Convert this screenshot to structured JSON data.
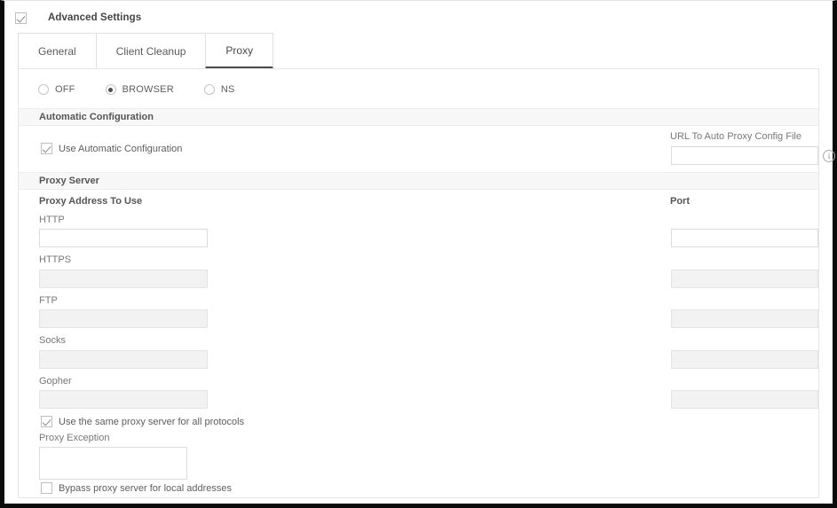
{
  "header": {
    "advanced_settings_label": "Advanced Settings",
    "advanced_settings_checked": true
  },
  "tabs": [
    {
      "label": "General",
      "active": false
    },
    {
      "label": "Client Cleanup",
      "active": false
    },
    {
      "label": "Proxy",
      "active": true
    }
  ],
  "proxy_mode": {
    "options": [
      {
        "label": "OFF",
        "selected": false
      },
      {
        "label": "BROWSER",
        "selected": true
      },
      {
        "label": "NS",
        "selected": false
      }
    ]
  },
  "automatic_configuration": {
    "section_title": "Automatic Configuration",
    "use_automatic_configuration_label": "Use Automatic Configuration",
    "use_automatic_configuration_checked": true,
    "url_label": "URL To Auto Proxy Config File",
    "url_value": "",
    "url_placeholder": "",
    "info_icon": "info-icon",
    "info_glyph": "i"
  },
  "proxy_server": {
    "section_title": "Proxy Server",
    "address_header": "Proxy Address To Use",
    "port_header": "Port",
    "rows": [
      {
        "protocol": "HTTP",
        "address_value": "",
        "address_disabled": false,
        "port_value": "",
        "port_disabled": false
      },
      {
        "protocol": "HTTPS",
        "address_value": "",
        "address_disabled": true,
        "port_value": "",
        "port_disabled": true
      },
      {
        "protocol": "FTP",
        "address_value": "",
        "address_disabled": true,
        "port_value": "",
        "port_disabled": true
      },
      {
        "protocol": "Socks",
        "address_value": "",
        "address_disabled": true,
        "port_value": "",
        "port_disabled": true
      },
      {
        "protocol": "Gopher",
        "address_value": "",
        "address_disabled": true,
        "port_value": "",
        "port_disabled": true
      }
    ],
    "same_proxy_label": "Use the same proxy server for all protocols",
    "same_proxy_checked": true,
    "exception_label": "Proxy Exception",
    "exception_value": "",
    "bypass_label": "Bypass proxy server for local addresses",
    "bypass_checked": false
  },
  "colors": {
    "section_bar_bg": "#f7f7f7",
    "border": "#e0e0e0",
    "text": "#5e5e5e",
    "active_tab_underline": "#4a4a4a",
    "disabled_field_bg": "#f2f2f2"
  }
}
